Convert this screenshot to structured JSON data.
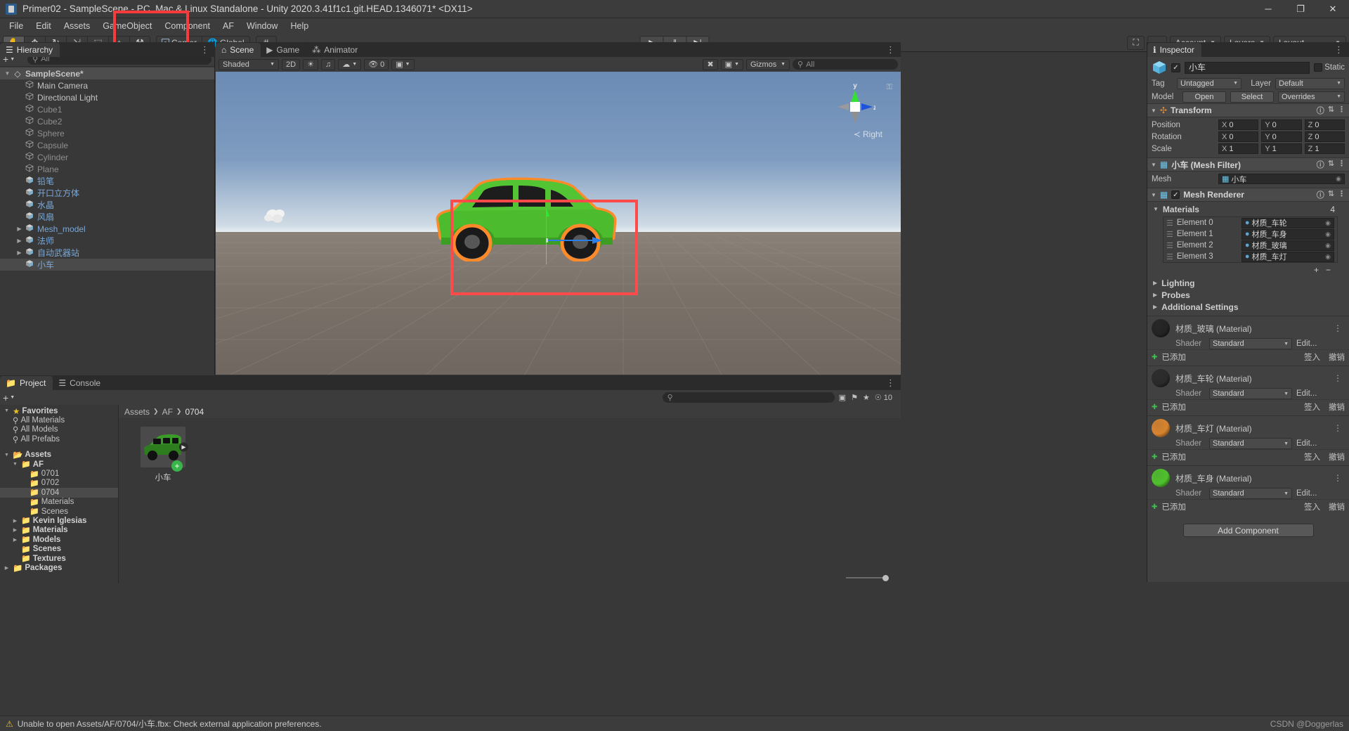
{
  "window": {
    "title": "Primer02 - SampleScene - PC, Mac & Linux Standalone - Unity 2020.3.41f1c1.git.HEAD.1346071* <DX11>",
    "minimize": "─",
    "maximize": "❐",
    "close": "✕"
  },
  "menu": [
    "File",
    "Edit",
    "Assets",
    "GameObject",
    "Component",
    "AF",
    "Window",
    "Help"
  ],
  "toolbar": {
    "tools": [
      {
        "name": "hand-tool",
        "glyph": "✋"
      },
      {
        "name": "move-tool",
        "glyph": "✥"
      },
      {
        "name": "rotate-tool",
        "glyph": "↻"
      },
      {
        "name": "scale-tool",
        "glyph": "⇲"
      },
      {
        "name": "rect-tool",
        "glyph": "⬚"
      },
      {
        "name": "transform-tool",
        "glyph": "⌖"
      },
      {
        "name": "custom-tool",
        "glyph": "⚒"
      }
    ],
    "pivot_mode": "Center",
    "pivot_rotation": "Global",
    "grid_snap": "#",
    "play": "▶",
    "pause": "‖",
    "step": "▶|",
    "collab": "☁",
    "cloud": "☁",
    "account": "Account",
    "layers": "Layers",
    "layout": "Layout",
    "search_icon": "⛶"
  },
  "hierarchy": {
    "tab": "Hierarchy",
    "tab_icon": "☰",
    "add_label": "+",
    "search_placeholder": "All",
    "scene": "SampleScene*",
    "items": [
      {
        "label": "Main Camera",
        "type": "gameobject",
        "dim": false
      },
      {
        "label": "Directional Light",
        "type": "gameobject",
        "dim": false
      },
      {
        "label": "Cube1",
        "type": "gameobject",
        "dim": true
      },
      {
        "label": "Cube2",
        "type": "gameobject",
        "dim": true
      },
      {
        "label": "Sphere",
        "type": "gameobject",
        "dim": true
      },
      {
        "label": "Capsule",
        "type": "gameobject",
        "dim": true
      },
      {
        "label": "Cylinder",
        "type": "gameobject",
        "dim": true
      },
      {
        "label": "Plane",
        "type": "gameobject",
        "dim": true
      },
      {
        "label": "铅笔",
        "type": "prefab",
        "dim": false
      },
      {
        "label": "开口立方体",
        "type": "prefab",
        "dim": false
      },
      {
        "label": "水晶",
        "type": "prefab",
        "dim": false
      },
      {
        "label": "风扇",
        "type": "prefab",
        "dim": false
      },
      {
        "label": "Mesh_model",
        "type": "prefab",
        "dim": false,
        "expandable": true
      },
      {
        "label": "法师",
        "type": "prefab",
        "dim": false,
        "expandable": true
      },
      {
        "label": "自动武器站",
        "type": "prefab",
        "dim": false,
        "expandable": true
      },
      {
        "label": "小车",
        "type": "prefab",
        "dim": false,
        "selected": true
      }
    ]
  },
  "scene_view": {
    "tabs": [
      {
        "label": "Scene",
        "icon": "⌂",
        "active": true
      },
      {
        "label": "Game",
        "icon": "▶",
        "active": false
      },
      {
        "label": "Animator",
        "icon": "⁂",
        "active": false
      }
    ],
    "shading": "Shaded",
    "mode_2d": "2D",
    "lighting_icon": "☀",
    "audio_icon": "♫",
    "fx_icon": "☁",
    "hidden_count": "0",
    "gizmos": "Gizmos",
    "search_placeholder": "All",
    "orientation": "Right",
    "axis_y": "y",
    "axis_z": "z",
    "lock_icon": "⚿"
  },
  "inspector": {
    "tab": "Inspector",
    "tab_icon": "ℹ",
    "object_name": "小车",
    "static_label": "Static",
    "tag_label": "Tag",
    "tag_value": "Untagged",
    "layer_label": "Layer",
    "layer_value": "Default",
    "model_label": "Model",
    "model_open": "Open",
    "model_select": "Select",
    "model_overrides": "Overrides",
    "transform": {
      "title": "Transform",
      "rows": [
        {
          "label": "Position",
          "x": "0",
          "y": "0",
          "z": "0"
        },
        {
          "label": "Rotation",
          "x": "0",
          "y": "0",
          "z": "0"
        },
        {
          "label": "Scale",
          "x": "1",
          "y": "1",
          "z": "1"
        }
      ],
      "axes": [
        "X",
        "Y",
        "Z"
      ]
    },
    "mesh_filter": {
      "title": "小车 (Mesh Filter)",
      "mesh_label": "Mesh",
      "mesh_value": "小车"
    },
    "mesh_renderer": {
      "title": "Mesh Renderer",
      "materials_label": "Materials",
      "materials_count": "4",
      "elements": [
        {
          "label": "Element 0",
          "value": "材质_车轮"
        },
        {
          "label": "Element 1",
          "value": "材质_车身"
        },
        {
          "label": "Element 2",
          "value": "材质_玻璃"
        },
        {
          "label": "Element 3",
          "value": "材质_车灯"
        }
      ],
      "add_btn": "+",
      "remove_btn": "−",
      "foldouts": [
        "Lighting",
        "Probes",
        "Additional Settings"
      ]
    },
    "materials": [
      {
        "name": "材质_玻璃 (Material)",
        "color": "#232323",
        "shader_label": "Shader",
        "shader": "Standard",
        "edit": "Edit...",
        "added": "已添加",
        "apply": "签入",
        "revert": "撤销"
      },
      {
        "name": "材质_车轮 (Material)",
        "color": "#2a2a2a",
        "shader_label": "Shader",
        "shader": "Standard",
        "edit": "Edit...",
        "added": "已添加",
        "apply": "签入",
        "revert": "撤销"
      },
      {
        "name": "材质_车灯 (Material)",
        "color": "#d8842f",
        "shader_label": "Shader",
        "shader": "Standard",
        "edit": "Edit...",
        "added": "已添加",
        "apply": "签入",
        "revert": "撤销"
      },
      {
        "name": "材质_车身 (Material)",
        "color": "#4fc12d",
        "shader_label": "Shader",
        "shader": "Standard",
        "edit": "Edit...",
        "added": "已添加",
        "apply": "签入",
        "revert": "撤销"
      }
    ],
    "add_component": "Add Component"
  },
  "project": {
    "tabs": [
      {
        "label": "Project",
        "icon": "▤",
        "active": true
      },
      {
        "label": "Console",
        "icon": "☰",
        "active": false
      }
    ],
    "add_label": "+",
    "search_icon": "⚲",
    "counter": "10",
    "favorites": {
      "label": "Favorites",
      "items": [
        "All Materials",
        "All Models",
        "All Prefabs"
      ]
    },
    "assets_label": "Assets",
    "tree": [
      {
        "label": "AF",
        "depth": 1,
        "expanded": true,
        "folder": true
      },
      {
        "label": "0701",
        "depth": 2,
        "folder": true
      },
      {
        "label": "0702",
        "depth": 2,
        "folder": true
      },
      {
        "label": "0704",
        "depth": 2,
        "folder": true,
        "selected": true
      },
      {
        "label": "Materials",
        "depth": 2,
        "folder": true
      },
      {
        "label": "Scenes",
        "depth": 2,
        "folder": true
      },
      {
        "label": "Kevin Iglesias",
        "depth": 1,
        "folder": true,
        "collapsed": true
      },
      {
        "label": "Materials",
        "depth": 1,
        "folder": true,
        "collapsed": true
      },
      {
        "label": "Models",
        "depth": 1,
        "folder": true,
        "collapsed": true
      },
      {
        "label": "Scenes",
        "depth": 1,
        "folder": true
      },
      {
        "label": "Textures",
        "depth": 1,
        "folder": true
      }
    ],
    "packages_label": "Packages",
    "breadcrumb": [
      "Assets",
      "AF",
      "0704"
    ],
    "assets": [
      {
        "label": "小车",
        "type": "model"
      }
    ]
  },
  "status": {
    "icon": "⚠",
    "message": "Unable to open Assets/AF/0704/小车.fbx: Check external application preferences.",
    "watermark": "CSDN @Doggerlas"
  }
}
